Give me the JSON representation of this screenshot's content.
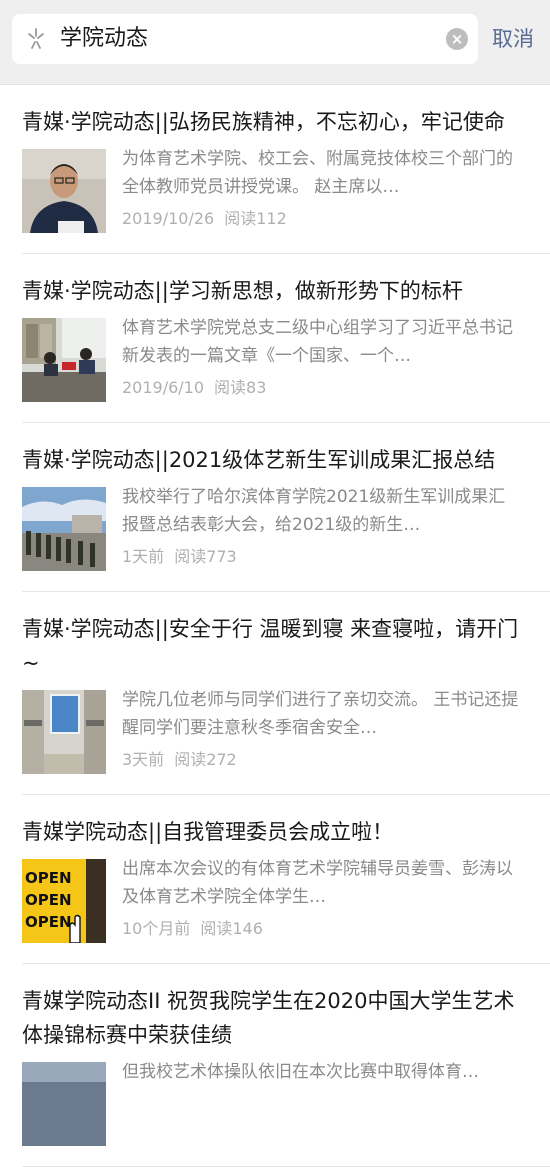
{
  "search": {
    "query": "学院动态",
    "cancel_label": "取消"
  },
  "results": [
    {
      "title": "青媒·学院动态||弘扬民族精神，不忘初心，牢记使命",
      "snippet": "为体育艺术学院、校工会、附属竞技体校三个部门的全体教师党员讲授党课。 赵主席以…",
      "date": "2019/10/26",
      "reads": "阅读112",
      "thumb": "man-portrait"
    },
    {
      "title": "青媒·学院动态||学习新思想，做新形势下的标杆",
      "snippet": "体育艺术学院党总支二级中心组学习了习近平总书记新发表的一篇文章《一个国家、一个…",
      "date": "2019/6/10",
      "reads": "阅读83",
      "thumb": "meeting-room"
    },
    {
      "title": "青媒·学院动态||2021级体艺新生军训成果汇报总结",
      "snippet": "我校举行了哈尔滨体育学院2021级新生军训成果汇报暨总结表彰大会，给2021级的新生…",
      "date": "1天前",
      "reads": "阅读773",
      "thumb": "military-parade"
    },
    {
      "title": "青媒·学院动态||安全于行 温暖到寝 来查寝啦，请开门~",
      "snippet": "学院几位老师与同学们进行了亲切交流。 王书记还提醒同学们要注意秋冬季宿舍安全…",
      "date": "3天前",
      "reads": "阅读272",
      "thumb": "dorm-room"
    },
    {
      "title": "青媒学院动态||自我管理委员会成立啦！",
      "snippet": "出席本次会议的有体育艺术学院辅导员姜雪、彭涛以及体育艺术学院全体学生…",
      "date": "10个月前",
      "reads": "阅读146",
      "thumb": "open-sign",
      "thumb_text": [
        "OPEN",
        "OPEN",
        "OPEN"
      ]
    },
    {
      "title": "青媒学院动态II 祝贺我院学生在2020中国大学生艺术体操锦标赛中荣获佳绩",
      "snippet": "但我校艺术体操队依旧在本次比赛中取得体育…",
      "date": "",
      "reads": "",
      "thumb": "gymnastics"
    }
  ]
}
